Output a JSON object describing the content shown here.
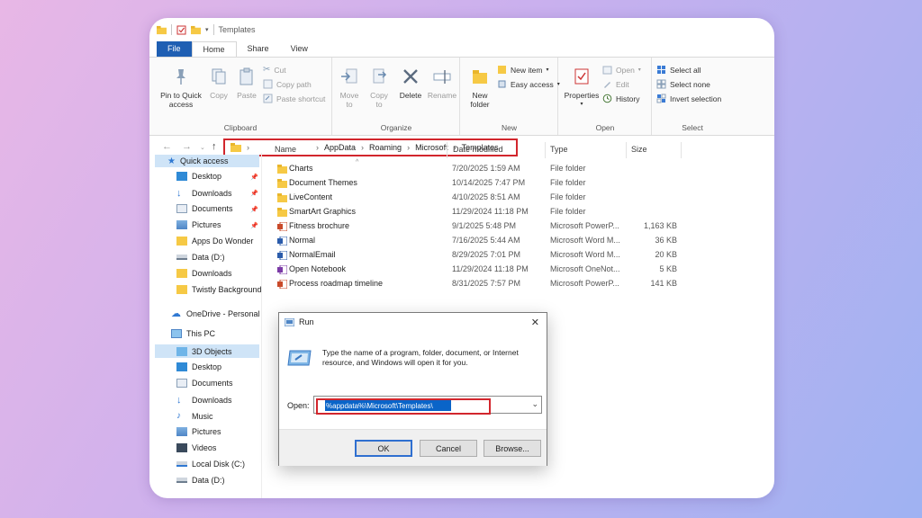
{
  "window": {
    "title": "Templates"
  },
  "tabs": [
    "File",
    "Home",
    "Share",
    "View"
  ],
  "ribbon": {
    "clipboard": {
      "label": "Clipboard",
      "pin": "Pin to Quick access",
      "copy": "Copy",
      "paste": "Paste",
      "cut": "Cut",
      "copy_path": "Copy path",
      "paste_shortcut": "Paste shortcut"
    },
    "organize": {
      "label": "Organize",
      "move_to": "Move to",
      "copy_to": "Copy to",
      "delete": "Delete",
      "rename": "Rename"
    },
    "new": {
      "label": "New",
      "new_folder": "New folder",
      "new_item": "New item",
      "easy_access": "Easy access"
    },
    "open": {
      "label": "Open",
      "properties": "Properties",
      "open": "Open",
      "edit": "Edit",
      "history": "History"
    },
    "select": {
      "label": "Select",
      "select_all": "Select all",
      "select_none": "Select none",
      "invert": "Invert selection"
    }
  },
  "address": {
    "crumbs": [
      "AppData",
      "Roaming",
      "Microsoft",
      "Templates"
    ],
    "sep": "›"
  },
  "columns": {
    "name": "Name",
    "date": "Date modified",
    "type": "Type",
    "size": "Size"
  },
  "sidebar": {
    "quick_access": "Quick access",
    "items": [
      {
        "label": "Desktop",
        "pinned": true
      },
      {
        "label": "Downloads",
        "pinned": true
      },
      {
        "label": "Documents",
        "pinned": true
      },
      {
        "label": "Pictures",
        "pinned": true
      },
      {
        "label": "Apps Do Wonder",
        "pinned": false
      },
      {
        "label": "Data (D:)",
        "pinned": false
      },
      {
        "label": "Downloads",
        "pinned": false
      },
      {
        "label": "Twistly Background",
        "pinned": false
      }
    ],
    "onedrive": "OneDrive - Personal",
    "this_pc": "This PC",
    "pc_items": [
      "3D Objects",
      "Desktop",
      "Documents",
      "Downloads",
      "Music",
      "Pictures",
      "Videos",
      "Local Disk (C:)",
      "Data (D:)"
    ]
  },
  "files": [
    {
      "name": "Charts",
      "date": "7/20/2025 1:59 AM",
      "type": "File folder",
      "size": "",
      "icon": "folder"
    },
    {
      "name": "Document Themes",
      "date": "10/14/2025 7:47 PM",
      "type": "File folder",
      "size": "",
      "icon": "folder"
    },
    {
      "name": "LiveContent",
      "date": "4/10/2025 8:51 AM",
      "type": "File folder",
      "size": "",
      "icon": "folder"
    },
    {
      "name": "SmartArt Graphics",
      "date": "11/29/2024 11:18 PM",
      "type": "File folder",
      "size": "",
      "icon": "folder"
    },
    {
      "name": "Fitness brochure",
      "date": "9/1/2025 5:48 PM",
      "type": "Microsoft PowerP...",
      "size": "1,163 KB",
      "icon": "powerpoint"
    },
    {
      "name": "Normal",
      "date": "7/16/2025 5:44 AM",
      "type": "Microsoft Word M...",
      "size": "36 KB",
      "icon": "word"
    },
    {
      "name": "NormalEmail",
      "date": "8/29/2025 7:01 PM",
      "type": "Microsoft Word M...",
      "size": "20 KB",
      "icon": "word"
    },
    {
      "name": "Open Notebook",
      "date": "11/29/2024 11:18 PM",
      "type": "Microsoft OneNot...",
      "size": "5 KB",
      "icon": "onenote"
    },
    {
      "name": "Process roadmap timeline",
      "date": "8/31/2025 7:57 PM",
      "type": "Microsoft PowerP...",
      "size": "141 KB",
      "icon": "powerpoint"
    }
  ],
  "run_dialog": {
    "title": "Run",
    "description": "Type the name of a program, folder, document, or Internet resource, and Windows will open it for you.",
    "open_label": "Open:",
    "value": "%appdata%\\Microsoft\\Templates\\",
    "ok": "OK",
    "cancel": "Cancel",
    "browse": "Browse..."
  },
  "colors": {
    "highlight_red": "#d2262d",
    "file_tab_blue": "#1f5fb3",
    "selection_blue": "#0a64c8",
    "folder_yellow": "#f6c945"
  }
}
